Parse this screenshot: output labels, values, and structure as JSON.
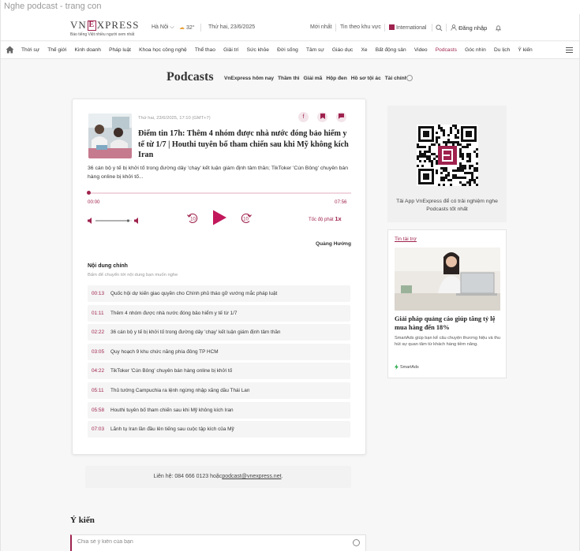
{
  "tab": {
    "title": "Nghe podcast - trang con"
  },
  "header": {
    "logo_word": "VNEXPRESS",
    "tagline": "Báo tiếng Việt nhiều người xem nhất",
    "location": "Hà Nội",
    "temperature": "32°",
    "date": "Thứ hai, 23/6/2025",
    "latest": "Mới nhất",
    "regional": "Tin theo khu vực",
    "international": "International",
    "login": "Đăng nhập"
  },
  "nav": {
    "items": [
      "Thời sự",
      "Thế giới",
      "Kinh doanh",
      "Pháp luật",
      "Khoa học công nghệ",
      "Thể thao",
      "Giải trí",
      "Sức khỏe",
      "Đời sống",
      "Tâm sự",
      "Giáo dục",
      "Xe",
      "Bất động sản",
      "Video",
      "Podcasts",
      "Góc nhìn",
      "Du lịch",
      "Ý kiến"
    ],
    "active": "Podcasts"
  },
  "podcasts": {
    "heading": "Podcasts",
    "tabs": [
      "VnExpress hôm nay",
      "Thầm thì",
      "Giải mã",
      "Hộp đen",
      "Hồ sơ tội ác",
      "Tài chính cá nhân"
    ]
  },
  "episode": {
    "date": "Thứ hai, 23/6/2025, 17:10 (GMT+7)",
    "title": "Điểm tin 17h: Thêm 4 nhóm được nhà nước đóng bảo hiểm y tế từ 1/7 | Houthi tuyên bố tham chiến sau khi Mỹ không kích Iran",
    "lead": "36 cán bộ y tế bị khởi tố trong đường dây 'chạy' kết luận giám định tâm thần; TikToker 'Cún Bông' chuyên bán hàng online bị khởi tố...",
    "current_time": "00:00",
    "duration": "07:56",
    "progress": 0,
    "volume": 0.9,
    "speed_label": "Tốc độ phát",
    "speed_value": "1x",
    "author": "Quảng Hưởng",
    "skip_back": "10",
    "skip_forward": "10"
  },
  "toc": {
    "heading": "Nội dung chính",
    "hint": "Bấm để chuyển tới nội dung bạn muốn nghe",
    "items": [
      {
        "time": "00:13",
        "text": "Quốc hội dự kiến giao quyền cho Chính phủ tháo gỡ vướng mắc pháp luật"
      },
      {
        "time": "01:11",
        "text": "Thêm 4 nhóm được nhà nước đóng bảo hiểm y tế từ 1/7"
      },
      {
        "time": "02:22",
        "text": "36 cán bộ y tế bị khởi tố trong đường dây 'chạy' kết luận giám định tâm thần"
      },
      {
        "time": "03:05",
        "text": "Quy hoạch 9 khu chức năng phía đông TP HCM"
      },
      {
        "time": "04:22",
        "text": "TikToker 'Cún Bông' chuyên bán hàng online bị khởi tố"
      },
      {
        "time": "05:11",
        "text": "Thủ tướng Campuchia ra lệnh ngừng nhập xăng dầu Thái Lan"
      },
      {
        "time": "05:58",
        "text": "Houthi tuyên bố tham chiến sau khi Mỹ không kích Iran"
      },
      {
        "time": "07:03",
        "text": "Lãnh tụ Iran lần đầu lên tiếng sau cuộc tập kích của Mỹ"
      }
    ]
  },
  "contact": {
    "prefix": "Liên hệ: 084 666 0123 hoặc",
    "email": "podcast@vnexpress.net",
    "suffix": "."
  },
  "comments": {
    "heading": "Ý kiến",
    "placeholder": "Chia sẻ ý kiến của bạn"
  },
  "app_promo": {
    "text": "Tải App VnExpress để có trải nghiệm nghe Podcasts tốt nhất"
  },
  "ad": {
    "label": "Tin tài trợ",
    "title": "Giải pháp quảng cáo giúp tăng tỷ lệ mua hàng đến 18%",
    "desc": "SmartAds giúp bạn kể câu chuyện thương hiệu và thu hút sự quan tâm từ khách hàng tiềm năng.",
    "brand": "SmartAds"
  },
  "colors": {
    "accent": "#9f224e",
    "background": "#f7f7f7"
  }
}
